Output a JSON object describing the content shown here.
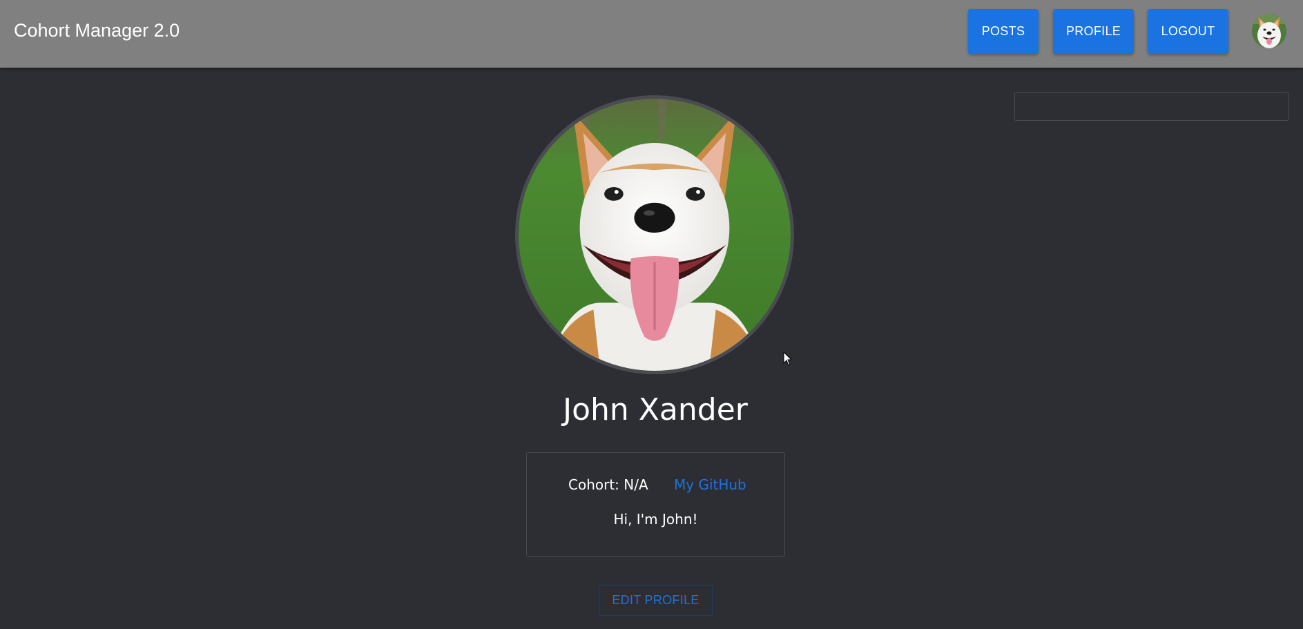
{
  "app": {
    "title": "Cohort Manager 2.0"
  },
  "nav": {
    "posts_label": "POSTS",
    "profile_label": "PROFILE",
    "logout_label": "LOGOUT",
    "avatar_icon": "dog-avatar-icon"
  },
  "search": {
    "value": "",
    "placeholder": ""
  },
  "profile": {
    "photo_icon": "dog-portrait-image",
    "name": "John Xander",
    "cohort": "Cohort: N/A",
    "github_label": "My GitHub",
    "bio": "Hi, I'm John!",
    "edit_label": "EDIT PROFILE"
  },
  "colors": {
    "appbar": "#808080",
    "background": "#2d2e33",
    "accent": "#1a73e0"
  }
}
